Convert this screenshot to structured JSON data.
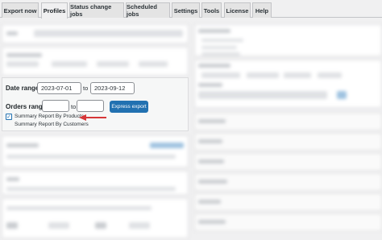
{
  "tabs": [
    {
      "label": "Export now",
      "active": false
    },
    {
      "label": "Profiles",
      "active": true
    },
    {
      "label": "Status change jobs",
      "active": false
    },
    {
      "label": "Scheduled jobs",
      "active": false
    },
    {
      "label": "Settings",
      "active": false
    },
    {
      "label": "Tools",
      "active": false
    },
    {
      "label": "License",
      "active": false
    },
    {
      "label": "Help",
      "active": false
    }
  ],
  "date_range": {
    "label": "Date range",
    "from": "2023-07-01",
    "to_label": "to",
    "to": "2023-09-12"
  },
  "orders_range": {
    "label": "Orders range",
    "from": "",
    "to_label": "to",
    "to": ""
  },
  "express_export_label": "Express export",
  "summary_options": [
    {
      "label": "Summary Report By Products",
      "checked": true
    },
    {
      "label": "Summary Report By Customers",
      "checked": false
    }
  ],
  "colors": {
    "accent": "#2271b1",
    "arrow": "#d63638"
  }
}
